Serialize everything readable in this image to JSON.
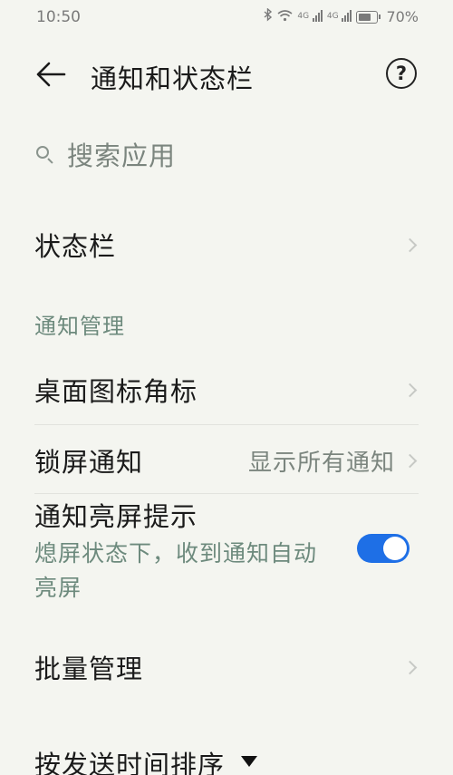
{
  "status_bar": {
    "time": "10:50",
    "battery": "70%",
    "net1": "4G",
    "net2": "4G",
    "icons": [
      "bluetooth-icon",
      "wifi-icon",
      "signal-icon",
      "signal-icon",
      "battery-icon"
    ]
  },
  "header": {
    "title": "通知和状态栏",
    "back_icon": "arrow-left-icon",
    "help_icon": "help-circle-icon",
    "help_glyph": "?"
  },
  "search": {
    "placeholder": "搜索应用",
    "icon": "search-icon"
  },
  "rows": {
    "status_bar": "状态栏",
    "section_title": "通知管理",
    "desktop_badge": "桌面图标角标",
    "lock_screen": "锁屏通知",
    "lock_screen_value": "显示所有通知",
    "wake_screen": "通知亮屏提示",
    "wake_screen_desc": "熄屏状态下，收到通知自动亮屏",
    "wake_screen_enabled": true,
    "batch_manage": "批量管理",
    "sort_by": "按发送时间排序"
  },
  "colors": {
    "accent": "#1e6fe6",
    "section": "#6d8a7d",
    "background": "#f4f5f0"
  }
}
